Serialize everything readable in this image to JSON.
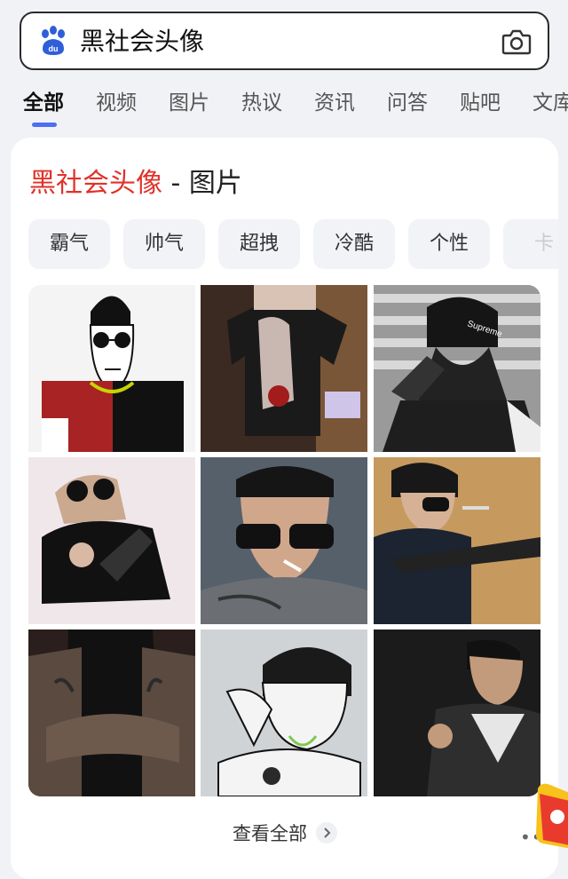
{
  "search": {
    "query": "黑社会头像",
    "icon_logo": "baidu-paw-logo",
    "icon_camera": "camera-icon"
  },
  "tabs": [
    {
      "label": "全部",
      "active": true
    },
    {
      "label": "视频",
      "active": false
    },
    {
      "label": "图片",
      "active": false
    },
    {
      "label": "热议",
      "active": false
    },
    {
      "label": "资讯",
      "active": false
    },
    {
      "label": "问答",
      "active": false
    },
    {
      "label": "贴吧",
      "active": false
    },
    {
      "label": "文库",
      "active": false
    }
  ],
  "card": {
    "title_keyword": "黑社会头像",
    "title_separator": "-",
    "title_suffix": "图片",
    "chips": [
      "霸气",
      "帅气",
      "超拽",
      "冷酷",
      "个性",
      "卡"
    ],
    "view_all_label": "查看全部",
    "more_label": "•••"
  },
  "colors": {
    "accent_blue": "#4e6ef2",
    "keyword_red": "#e0322a",
    "page_bg": "#f1f2f6"
  }
}
